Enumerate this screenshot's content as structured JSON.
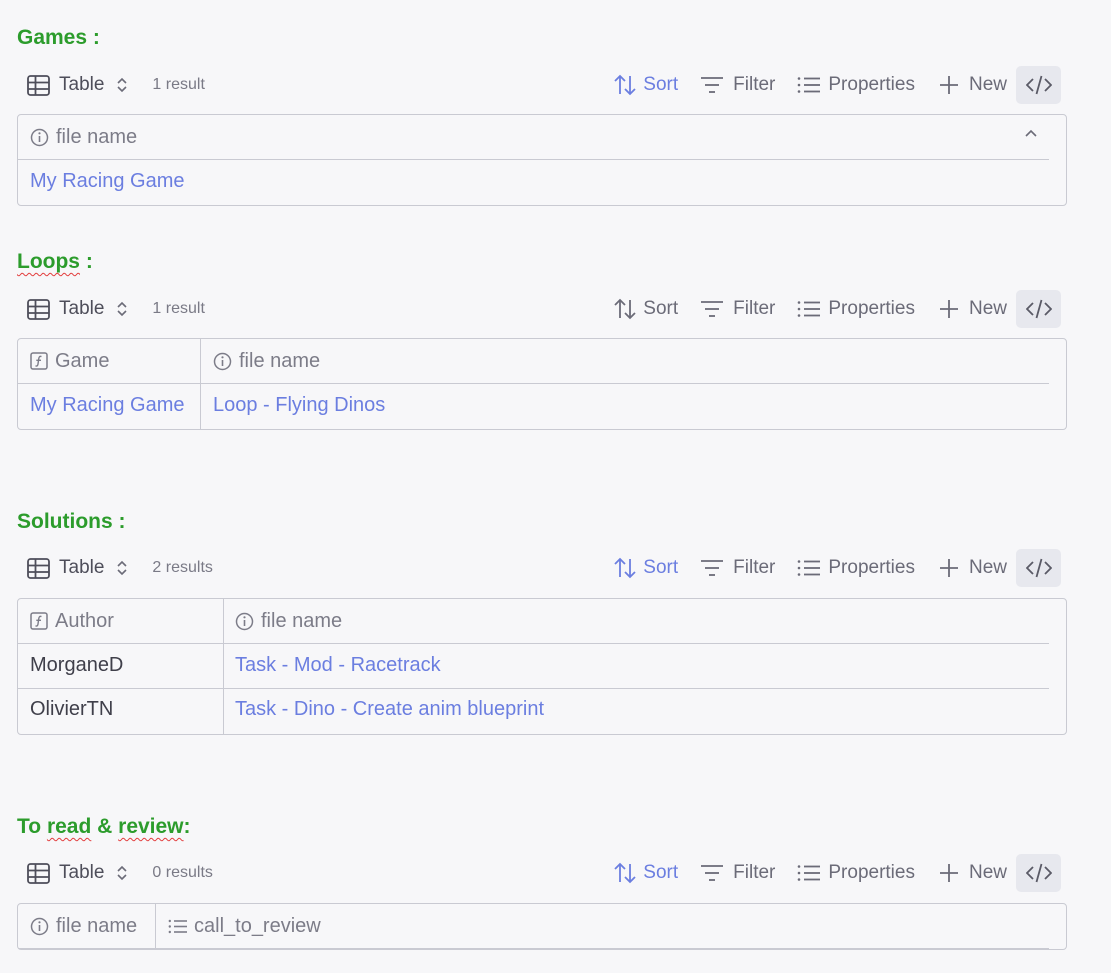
{
  "toolbar": {
    "view_label": "Table",
    "sort_label": "Sort",
    "filter_label": "Filter",
    "properties_label": "Properties",
    "new_label": "New"
  },
  "sections": {
    "games": {
      "heading": "Games :",
      "result_count": "1 result",
      "columns": [
        "file name"
      ],
      "rows": [
        [
          "My Racing Game"
        ]
      ]
    },
    "loops": {
      "heading_word": "Loops",
      "heading_suffix": " :",
      "result_count": "1 result",
      "columns": [
        "Game",
        "file name"
      ],
      "rows": [
        [
          "My Racing Game",
          "Loop - Flying Dinos"
        ]
      ]
    },
    "solutions": {
      "heading": "Solutions :",
      "result_count": "2 results",
      "columns": [
        "Author",
        "file name"
      ],
      "rows": [
        [
          "MorganeD",
          "Task - Mod - Racetrack"
        ],
        [
          "OlivierTN",
          "Task - Dino - Create anim blueprint"
        ]
      ]
    },
    "to_review": {
      "heading_a": "To ",
      "heading_read": "read",
      "heading_b": " & ",
      "heading_review": "review",
      "heading_c": ":",
      "result_count": "0 results",
      "columns": [
        "file name",
        "call_to_review"
      ]
    }
  },
  "icons": {
    "view": "table-grid-icon",
    "switch": "chevron-updown-icon",
    "sort": "sort-arrows-icon",
    "filter": "filter-lines-icon",
    "properties": "list-icon",
    "new": "plus-icon",
    "code": "code-icon",
    "text_property": "info-circle-icon",
    "formula_property": "function-box-icon",
    "list_property": "list-icon"
  },
  "colors": {
    "heading": "#2c9c2c",
    "link": "#6b7ee0",
    "border": "#c9cad2",
    "background": "#f7f7f9"
  }
}
